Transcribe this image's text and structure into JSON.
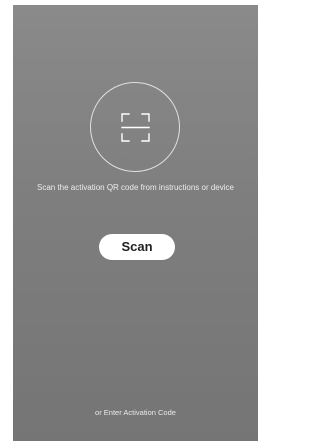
{
  "scan_screen": {
    "qr_icon": "qr-scan-frame-icon",
    "instruction": "Scan the activation QR code from instructions or device",
    "scan_button_label": "Scan",
    "enter_code_link": "or Enter Activation Code"
  },
  "colors": {
    "background_top": "#8a8a8a",
    "background_bottom": "#757575",
    "button_background": "#ffffff",
    "button_text": "#222222",
    "text": "#ffffff"
  }
}
